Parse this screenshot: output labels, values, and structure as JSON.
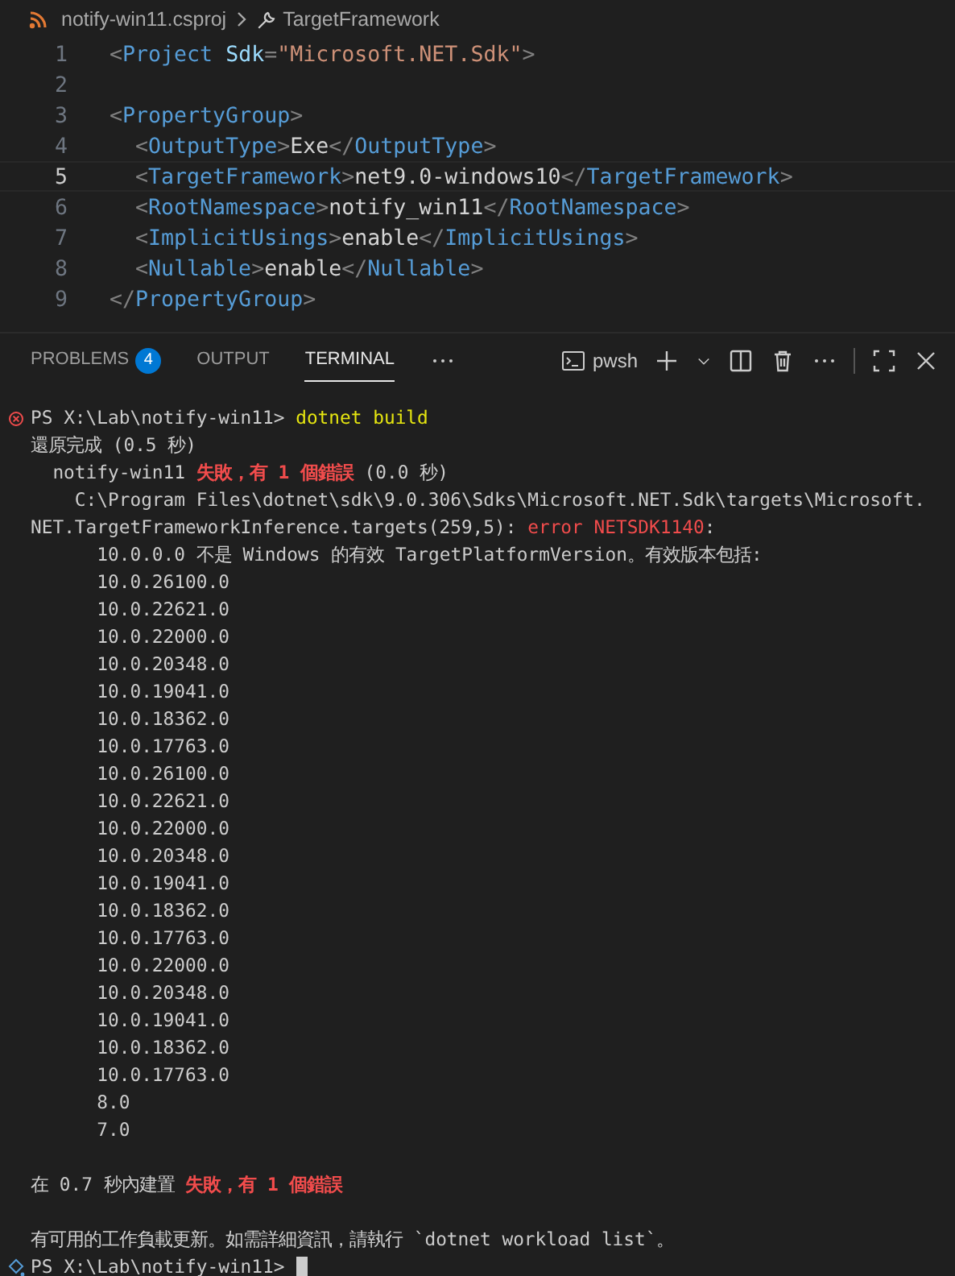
{
  "breadcrumb": {
    "file": "notify-win11.csproj",
    "symbol": "TargetFramework"
  },
  "editor": {
    "lines": [
      {
        "number": "1",
        "current": false,
        "tokens": [
          {
            "kind": "punct",
            "text": "<"
          },
          {
            "kind": "tag",
            "text": "Project"
          },
          {
            "kind": "attr",
            "text": " Sdk"
          },
          {
            "kind": "punct",
            "text": "="
          },
          {
            "kind": "string",
            "text": "\"Microsoft.NET.Sdk\""
          },
          {
            "kind": "punct",
            "text": ">"
          }
        ],
        "children": [
          {
            "number": "2",
            "current": false
          },
          {
            "number": "3",
            "current": false,
            "tokens": [
              {
                "kind": "punct",
                "text": "<"
              },
              {
                "kind": "tag",
                "text": "PropertyGroup"
              },
              {
                "kind": "punct",
                "text": ">"
              }
            ],
            "children": [
              {
                "number": "4",
                "current": false,
                "tokens": [
                  {
                    "kind": "punct",
                    "text": "<"
                  },
                  {
                    "kind": "tag",
                    "text": "OutputType"
                  },
                  {
                    "kind": "punct",
                    "text": ">"
                  },
                  {
                    "kind": "text",
                    "text": "Exe"
                  },
                  {
                    "kind": "punct",
                    "text": "</"
                  },
                  {
                    "kind": "tag",
                    "text": "OutputType"
                  },
                  {
                    "kind": "punct",
                    "text": ">"
                  }
                ]
              },
              {
                "number": "5",
                "current": true,
                "tokens": [
                  {
                    "kind": "punct",
                    "text": "<"
                  },
                  {
                    "kind": "tag",
                    "text": "TargetFramework"
                  },
                  {
                    "kind": "punct",
                    "text": ">"
                  },
                  {
                    "kind": "text",
                    "text": "net9.0-windows10"
                  },
                  {
                    "kind": "punct",
                    "text": "</"
                  },
                  {
                    "kind": "tag",
                    "text": "TargetFramework"
                  },
                  {
                    "kind": "punct",
                    "text": ">"
                  }
                ]
              },
              {
                "number": "6",
                "current": false,
                "tokens": [
                  {
                    "kind": "punct",
                    "text": "<"
                  },
                  {
                    "kind": "tag",
                    "text": "RootNamespace"
                  },
                  {
                    "kind": "punct",
                    "text": ">"
                  },
                  {
                    "kind": "text",
                    "text": "notify_win11"
                  },
                  {
                    "kind": "punct",
                    "text": "</"
                  },
                  {
                    "kind": "tag",
                    "text": "RootNamespace"
                  },
                  {
                    "kind": "punct",
                    "text": ">"
                  }
                ]
              },
              {
                "number": "7",
                "current": false,
                "tokens": [
                  {
                    "kind": "punct",
                    "text": "<"
                  },
                  {
                    "kind": "tag",
                    "text": "ImplicitUsings"
                  },
                  {
                    "kind": "punct",
                    "text": ">"
                  },
                  {
                    "kind": "text",
                    "text": "enable"
                  },
                  {
                    "kind": "punct",
                    "text": "</"
                  },
                  {
                    "kind": "tag",
                    "text": "ImplicitUsings"
                  },
                  {
                    "kind": "punct",
                    "text": ">"
                  }
                ]
              },
              {
                "number": "8",
                "current": false,
                "tokens": [
                  {
                    "kind": "punct",
                    "text": "<"
                  },
                  {
                    "kind": "tag",
                    "text": "Nullable"
                  },
                  {
                    "kind": "punct",
                    "text": ">"
                  },
                  {
                    "kind": "text",
                    "text": "enable"
                  },
                  {
                    "kind": "punct",
                    "text": "</"
                  },
                  {
                    "kind": "tag",
                    "text": "Nullable"
                  },
                  {
                    "kind": "punct",
                    "text": ">"
                  }
                ]
              }
            ]
          },
          {
            "number": "9",
            "current": false,
            "tokens": [
              {
                "kind": "punct",
                "text": "</"
              },
              {
                "kind": "tag",
                "text": "PropertyGroup"
              },
              {
                "kind": "punct",
                "text": ">"
              }
            ]
          }
        ]
      }
    ]
  },
  "panel_tabs": [
    {
      "label": "PROBLEMS",
      "badge": "4",
      "selected": false
    },
    {
      "label": "OUTPUT",
      "selected": false
    },
    {
      "label": "TERMINAL",
      "selected": true
    }
  ],
  "terminal_name": "pwsh",
  "terminal": {
    "lines": [
      {
        "kind": "prompt-error",
        "segments": [
          {
            "kind": "plain",
            "text": "PS X:\\Lab\\notify-win11> "
          },
          {
            "kind": "command",
            "text": "dotnet build"
          }
        ]
      },
      {
        "kind": "text",
        "segments": [
          {
            "kind": "plain",
            "text": "還原完成 (0.5 秒)"
          }
        ]
      },
      {
        "kind": "project",
        "segments": [
          {
            "kind": "plain",
            "text": "notify-win11 "
          },
          {
            "kind": "error",
            "text": "失敗，有 1 個錯誤"
          },
          {
            "kind": "plain",
            "text": " (0.0 秒)"
          }
        ]
      },
      {
        "kind": "path",
        "segments": [
          {
            "kind": "plain",
            "text": "C:\\Program Files\\dotnet\\sdk\\9.0.306\\Sdks\\Microsoft.NET.Sdk\\targets\\Microsoft."
          }
        ]
      },
      {
        "kind": "text",
        "segments": [
          {
            "kind": "plain",
            "text": "NET.TargetFrameworkInference.targets(259,5): "
          },
          {
            "kind": "error-plain",
            "text": "error NETSDK1140"
          },
          {
            "kind": "plain",
            "text": ":"
          }
        ]
      },
      {
        "kind": "detail",
        "segments": [
          {
            "kind": "plain",
            "text": "10.0.0.0 不是 Windows 的有效 TargetPlatformVersion。有效版本包括:"
          }
        ]
      },
      {
        "kind": "detail",
        "segments": [
          {
            "kind": "plain",
            "text": "10.0.26100.0"
          }
        ]
      },
      {
        "kind": "detail",
        "segments": [
          {
            "kind": "plain",
            "text": "10.0.22621.0"
          }
        ]
      },
      {
        "kind": "detail",
        "segments": [
          {
            "kind": "plain",
            "text": "10.0.22000.0"
          }
        ]
      },
      {
        "kind": "detail",
        "segments": [
          {
            "kind": "plain",
            "text": "10.0.20348.0"
          }
        ]
      },
      {
        "kind": "detail",
        "segments": [
          {
            "kind": "plain",
            "text": "10.0.19041.0"
          }
        ]
      },
      {
        "kind": "detail",
        "segments": [
          {
            "kind": "plain",
            "text": "10.0.18362.0"
          }
        ]
      },
      {
        "kind": "detail",
        "segments": [
          {
            "kind": "plain",
            "text": "10.0.17763.0"
          }
        ]
      },
      {
        "kind": "detail",
        "segments": [
          {
            "kind": "plain",
            "text": "10.0.26100.0"
          }
        ]
      },
      {
        "kind": "detail",
        "segments": [
          {
            "kind": "plain",
            "text": "10.0.22621.0"
          }
        ]
      },
      {
        "kind": "detail",
        "segments": [
          {
            "kind": "plain",
            "text": "10.0.22000.0"
          }
        ]
      },
      {
        "kind": "detail",
        "segments": [
          {
            "kind": "plain",
            "text": "10.0.20348.0"
          }
        ]
      },
      {
        "kind": "detail",
        "segments": [
          {
            "kind": "plain",
            "text": "10.0.19041.0"
          }
        ]
      },
      {
        "kind": "detail",
        "segments": [
          {
            "kind": "plain",
            "text": "10.0.18362.0"
          }
        ]
      },
      {
        "kind": "detail",
        "segments": [
          {
            "kind": "plain",
            "text": "10.0.17763.0"
          }
        ]
      },
      {
        "kind": "detail",
        "segments": [
          {
            "kind": "plain",
            "text": "10.0.22000.0"
          }
        ]
      },
      {
        "kind": "detail",
        "segments": [
          {
            "kind": "plain",
            "text": "10.0.20348.0"
          }
        ]
      },
      {
        "kind": "detail",
        "segments": [
          {
            "kind": "plain",
            "text": "10.0.19041.0"
          }
        ]
      },
      {
        "kind": "detail",
        "segments": [
          {
            "kind": "plain",
            "text": "10.0.18362.0"
          }
        ]
      },
      {
        "kind": "detail",
        "segments": [
          {
            "kind": "plain",
            "text": "10.0.17763.0"
          }
        ]
      },
      {
        "kind": "detail",
        "segments": [
          {
            "kind": "plain",
            "text": "8.0"
          }
        ]
      },
      {
        "kind": "detail",
        "segments": [
          {
            "kind": "plain",
            "text": "7.0"
          }
        ]
      },
      {
        "kind": "blank"
      },
      {
        "kind": "text",
        "segments": [
          {
            "kind": "plain",
            "text": "在 0.7 秒內建置 "
          },
          {
            "kind": "error",
            "text": "失敗，有 1 個錯誤"
          }
        ]
      },
      {
        "kind": "blank"
      },
      {
        "kind": "text",
        "segments": [
          {
            "kind": "plain",
            "text": "有可用的工作負載更新。如需詳細資訊，請執行 `dotnet workload list`。"
          }
        ]
      },
      {
        "kind": "prompt",
        "segments": [
          {
            "kind": "plain",
            "text": "PS X:\\Lab\\notify-win11> "
          }
        ]
      }
    ]
  }
}
